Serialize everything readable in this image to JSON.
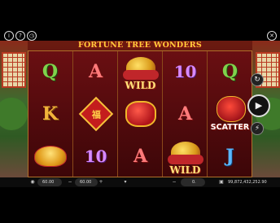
{
  "game": {
    "title": "FORTUNE TREE WONDERS"
  },
  "top_icons": {
    "info": "info-icon",
    "help": "help-icon",
    "history": "history-icon",
    "close": "close-icon"
  },
  "reels": [
    {
      "symbols": [
        {
          "type": "letter",
          "label": "Q",
          "color": "#7fd24b"
        },
        {
          "type": "letter",
          "label": "K",
          "color": "#f2b33a"
        },
        {
          "type": "image",
          "name": "gold-ingot-symbol"
        }
      ]
    },
    {
      "symbols": [
        {
          "type": "letter",
          "label": "A",
          "color": "#ff7b7b"
        },
        {
          "type": "image",
          "name": "fu-diamond-symbol"
        },
        {
          "type": "letter",
          "label": "10",
          "color": "#d889ff"
        }
      ]
    },
    {
      "symbols": [
        {
          "type": "wild",
          "label": "WILD"
        },
        {
          "type": "image",
          "name": "red-lantern-symbol"
        },
        {
          "type": "letter",
          "label": "A",
          "color": "#ff7b7b"
        }
      ]
    },
    {
      "symbols": [
        {
          "type": "letter",
          "label": "10",
          "color": "#d889ff"
        },
        {
          "type": "letter",
          "label": "A",
          "color": "#ff7b7b"
        },
        {
          "type": "wild",
          "label": "WILD"
        }
      ]
    },
    {
      "symbols": [
        {
          "type": "letter",
          "label": "Q",
          "color": "#7fd24b"
        },
        {
          "type": "scatter",
          "label": "SCATTER"
        },
        {
          "type": "letter",
          "label": "J",
          "color": "#59b8ff"
        }
      ]
    }
  ],
  "controls": {
    "autoplay_icon": "refresh-icon",
    "spin_icon": "spin-icon",
    "turbo_icon": "lightning-icon"
  },
  "bottom_bar": {
    "balance": "60.00",
    "bet": "60.00",
    "win": "0.",
    "total": "99,872,432,252.90"
  },
  "colors": {
    "title_gold": "#ffcf3a",
    "reel_bg": "#6a0f12"
  }
}
